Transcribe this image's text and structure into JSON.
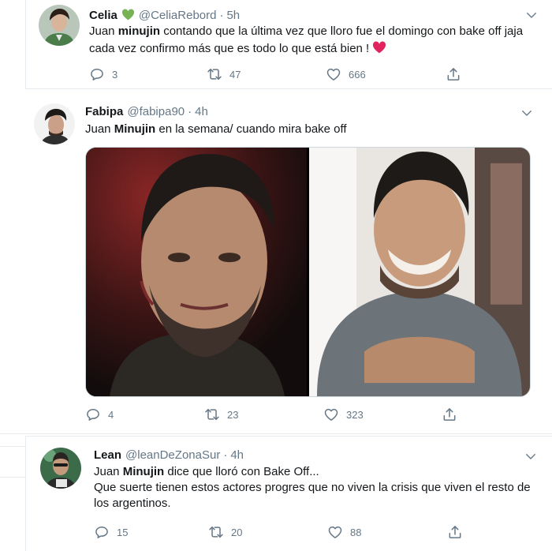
{
  "tweets": [
    {
      "name": "Celia",
      "handle": "@CeliaRebord",
      "separator": "·",
      "time": "5h",
      "text_before": "Juan ",
      "text_bold": "minujin",
      "text_after": " contando que la última vez que lloro fue el domingo con bake off jaja cada vez confirmo más que es todo lo que está bien !",
      "replies": "3",
      "retweets": "47",
      "likes": "666"
    },
    {
      "name": "Fabipa",
      "handle": "@fabipa90",
      "separator": "·",
      "time": "4h",
      "text_before": "Juan ",
      "text_bold": "Minujin",
      "text_after": " en la semana/ cuando mira bake off",
      "replies": "4",
      "retweets": "23",
      "likes": "323"
    },
    {
      "name": "Lean",
      "handle": "@leanDeZonaSur",
      "separator": "·",
      "time": "4h",
      "text_before": "Juan ",
      "text_bold": "Minujin",
      "text_after": " dice que lloró con Bake Off...",
      "text_line2": "Que suerte tienen estos actores progres que no viven la crisis que viven el resto de los argentinos.",
      "replies": "15",
      "retweets": "20",
      "likes": "88"
    }
  ],
  "colors": {
    "name": "#14171a",
    "secondary": "#657786",
    "border": "#e6ecf0",
    "heart_emoji": "#e0245e",
    "green_heart_emoji": "#77b255"
  },
  "icons": [
    "reply-icon",
    "retweet-icon",
    "like-icon",
    "share-icon",
    "chevron-down-icon",
    "green-heart-emoji",
    "red-heart-emoji"
  ]
}
